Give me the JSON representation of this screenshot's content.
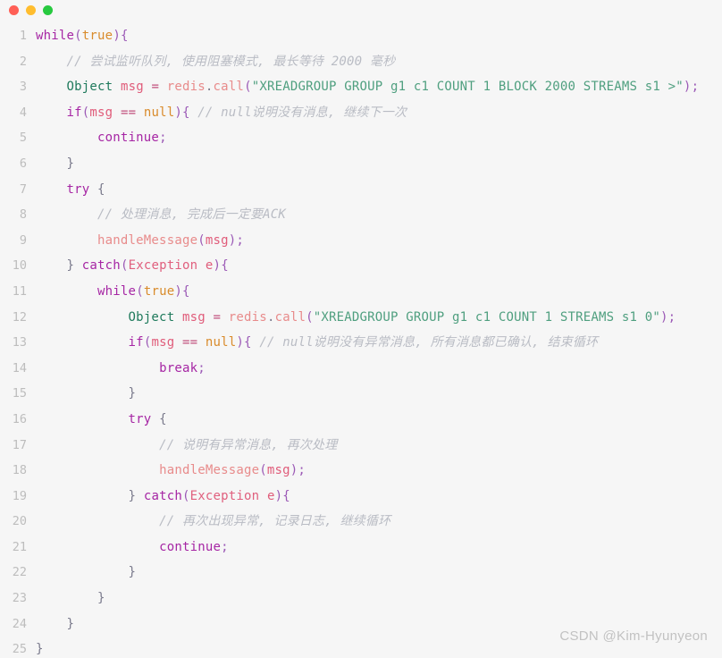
{
  "window": {
    "controls": [
      {
        "name": "close",
        "color": "#ff5f56"
      },
      {
        "name": "minimize",
        "color": "#ffbd2e"
      },
      {
        "name": "maximize",
        "color": "#27c93f"
      }
    ],
    "background": "#f6f6f6"
  },
  "watermark": "CSDN @Kim-Hyunyeon",
  "code": {
    "language": "java",
    "line_numbers": [
      "1",
      "2",
      "3",
      "4",
      "5",
      "6",
      "7",
      "8",
      "9",
      "10",
      "11",
      "12",
      "13",
      "14",
      "15",
      "16",
      "17",
      "18",
      "19",
      "20",
      "21",
      "22",
      "23",
      "24",
      "25"
    ],
    "lines": [
      {
        "n": "1",
        "text": "while(true){"
      },
      {
        "n": "2",
        "text": "    // 尝试监听队列, 使用阻塞模式, 最长等待 2000 毫秒"
      },
      {
        "n": "3",
        "text": "    Object msg = redis.call(\"XREADGROUP GROUP g1 c1 COUNT 1 BLOCK 2000 STREAMS s1 >\");"
      },
      {
        "n": "4",
        "text": "    if(msg == null){ // null说明没有消息, 继续下一次"
      },
      {
        "n": "5",
        "text": "        continue;"
      },
      {
        "n": "6",
        "text": "    }"
      },
      {
        "n": "7",
        "text": "    try {"
      },
      {
        "n": "8",
        "text": "        // 处理消息, 完成后一定要ACK"
      },
      {
        "n": "9",
        "text": "        handleMessage(msg);"
      },
      {
        "n": "10",
        "text": "    } catch(Exception e){"
      },
      {
        "n": "11",
        "text": "        while(true){"
      },
      {
        "n": "12",
        "text": "            Object msg = redis.call(\"XREADGROUP GROUP g1 c1 COUNT 1 STREAMS s1 0\");"
      },
      {
        "n": "13",
        "text": "            if(msg == null){ // null说明没有异常消息, 所有消息都已确认, 结束循环"
      },
      {
        "n": "14",
        "text": "                break;"
      },
      {
        "n": "15",
        "text": "            }"
      },
      {
        "n": "16",
        "text": "            try {"
      },
      {
        "n": "17",
        "text": "                // 说明有异常消息, 再次处理"
      },
      {
        "n": "18",
        "text": "                handleMessage(msg);"
      },
      {
        "n": "19",
        "text": "            } catch(Exception e){"
      },
      {
        "n": "20",
        "text": "                // 再次出现异常, 记录日志, 继续循环"
      },
      {
        "n": "21",
        "text": "                continue;"
      },
      {
        "n": "22",
        "text": "            }"
      },
      {
        "n": "23",
        "text": "        }"
      },
      {
        "n": "24",
        "text": "    }"
      },
      {
        "n": "25",
        "text": "}"
      }
    ],
    "tokens": [
      [
        {
          "t": "while",
          "c": "kw"
        },
        {
          "t": "(",
          "c": "pun"
        },
        {
          "t": "true",
          "c": "lit"
        },
        {
          "t": ")",
          "c": "pun"
        },
        {
          "t": "{",
          "c": "pun"
        }
      ],
      [
        {
          "t": "    ",
          "c": "pun2"
        },
        {
          "t": "// 尝试监听队列, 使用阻塞模式, 最长等待 2000 毫秒",
          "c": "cmt"
        }
      ],
      [
        {
          "t": "    ",
          "c": "pun2"
        },
        {
          "t": "Object",
          "c": "typ"
        },
        {
          "t": " ",
          "c": "pun2"
        },
        {
          "t": "msg",
          "c": "var"
        },
        {
          "t": " ",
          "c": "pun2"
        },
        {
          "t": "=",
          "c": "op"
        },
        {
          "t": " ",
          "c": "pun2"
        },
        {
          "t": "redis",
          "c": "fn"
        },
        {
          "t": ".",
          "c": "pun2"
        },
        {
          "t": "call",
          "c": "fn"
        },
        {
          "t": "(",
          "c": "pun"
        },
        {
          "t": "\"XREADGROUP GROUP g1 c1 COUNT 1 BLOCK 2000 STREAMS s1 >\"",
          "c": "str"
        },
        {
          "t": ")",
          "c": "pun"
        },
        {
          "t": ";",
          "c": "pun"
        }
      ],
      [
        {
          "t": "    ",
          "c": "pun2"
        },
        {
          "t": "if",
          "c": "kw"
        },
        {
          "t": "(",
          "c": "pun"
        },
        {
          "t": "msg",
          "c": "var"
        },
        {
          "t": " ",
          "c": "pun2"
        },
        {
          "t": "==",
          "c": "op"
        },
        {
          "t": " ",
          "c": "pun2"
        },
        {
          "t": "null",
          "c": "lit"
        },
        {
          "t": ")",
          "c": "pun"
        },
        {
          "t": "{",
          "c": "pun"
        },
        {
          "t": " ",
          "c": "pun2"
        },
        {
          "t": "// null说明没有消息, 继续下一次",
          "c": "cmt"
        }
      ],
      [
        {
          "t": "        ",
          "c": "pun2"
        },
        {
          "t": "continue",
          "c": "kw"
        },
        {
          "t": ";",
          "c": "pun"
        }
      ],
      [
        {
          "t": "    ",
          "c": "pun2"
        },
        {
          "t": "}",
          "c": "pun2"
        }
      ],
      [
        {
          "t": "    ",
          "c": "pun2"
        },
        {
          "t": "try",
          "c": "kw"
        },
        {
          "t": " ",
          "c": "pun2"
        },
        {
          "t": "{",
          "c": "pun2"
        }
      ],
      [
        {
          "t": "        ",
          "c": "pun2"
        },
        {
          "t": "// 处理消息, 完成后一定要ACK",
          "c": "cmt"
        }
      ],
      [
        {
          "t": "        ",
          "c": "pun2"
        },
        {
          "t": "handleMessage",
          "c": "fn"
        },
        {
          "t": "(",
          "c": "pun"
        },
        {
          "t": "msg",
          "c": "var"
        },
        {
          "t": ")",
          "c": "pun"
        },
        {
          "t": ";",
          "c": "pun"
        }
      ],
      [
        {
          "t": "    ",
          "c": "pun2"
        },
        {
          "t": "}",
          "c": "pun2"
        },
        {
          "t": " ",
          "c": "pun2"
        },
        {
          "t": "catch",
          "c": "kw"
        },
        {
          "t": "(",
          "c": "pun"
        },
        {
          "t": "Exception",
          "c": "cls"
        },
        {
          "t": " ",
          "c": "pun2"
        },
        {
          "t": "e",
          "c": "var"
        },
        {
          "t": ")",
          "c": "pun"
        },
        {
          "t": "{",
          "c": "pun"
        }
      ],
      [
        {
          "t": "        ",
          "c": "pun2"
        },
        {
          "t": "while",
          "c": "kw"
        },
        {
          "t": "(",
          "c": "pun"
        },
        {
          "t": "true",
          "c": "lit"
        },
        {
          "t": ")",
          "c": "pun"
        },
        {
          "t": "{",
          "c": "pun"
        }
      ],
      [
        {
          "t": "            ",
          "c": "pun2"
        },
        {
          "t": "Object",
          "c": "typ"
        },
        {
          "t": " ",
          "c": "pun2"
        },
        {
          "t": "msg",
          "c": "var"
        },
        {
          "t": " ",
          "c": "pun2"
        },
        {
          "t": "=",
          "c": "op"
        },
        {
          "t": " ",
          "c": "pun2"
        },
        {
          "t": "redis",
          "c": "fn"
        },
        {
          "t": ".",
          "c": "pun2"
        },
        {
          "t": "call",
          "c": "fn"
        },
        {
          "t": "(",
          "c": "pun"
        },
        {
          "t": "\"XREADGROUP GROUP g1 c1 COUNT 1 STREAMS s1 0\"",
          "c": "str"
        },
        {
          "t": ")",
          "c": "pun"
        },
        {
          "t": ";",
          "c": "pun"
        }
      ],
      [
        {
          "t": "            ",
          "c": "pun2"
        },
        {
          "t": "if",
          "c": "kw"
        },
        {
          "t": "(",
          "c": "pun"
        },
        {
          "t": "msg",
          "c": "var"
        },
        {
          "t": " ",
          "c": "pun2"
        },
        {
          "t": "==",
          "c": "op"
        },
        {
          "t": " ",
          "c": "pun2"
        },
        {
          "t": "null",
          "c": "lit"
        },
        {
          "t": ")",
          "c": "pun"
        },
        {
          "t": "{",
          "c": "pun"
        },
        {
          "t": " ",
          "c": "pun2"
        },
        {
          "t": "// null说明没有异常消息, 所有消息都已确认, 结束循环",
          "c": "cmt"
        }
      ],
      [
        {
          "t": "                ",
          "c": "pun2"
        },
        {
          "t": "break",
          "c": "kw"
        },
        {
          "t": ";",
          "c": "pun"
        }
      ],
      [
        {
          "t": "            ",
          "c": "pun2"
        },
        {
          "t": "}",
          "c": "pun2"
        }
      ],
      [
        {
          "t": "            ",
          "c": "pun2"
        },
        {
          "t": "try",
          "c": "kw"
        },
        {
          "t": " ",
          "c": "pun2"
        },
        {
          "t": "{",
          "c": "pun2"
        }
      ],
      [
        {
          "t": "                ",
          "c": "pun2"
        },
        {
          "t": "// 说明有异常消息, 再次处理",
          "c": "cmt"
        }
      ],
      [
        {
          "t": "                ",
          "c": "pun2"
        },
        {
          "t": "handleMessage",
          "c": "fn"
        },
        {
          "t": "(",
          "c": "pun"
        },
        {
          "t": "msg",
          "c": "var"
        },
        {
          "t": ")",
          "c": "pun"
        },
        {
          "t": ";",
          "c": "pun"
        }
      ],
      [
        {
          "t": "            ",
          "c": "pun2"
        },
        {
          "t": "}",
          "c": "pun2"
        },
        {
          "t": " ",
          "c": "pun2"
        },
        {
          "t": "catch",
          "c": "kw"
        },
        {
          "t": "(",
          "c": "pun"
        },
        {
          "t": "Exception",
          "c": "cls"
        },
        {
          "t": " ",
          "c": "pun2"
        },
        {
          "t": "e",
          "c": "var"
        },
        {
          "t": ")",
          "c": "pun"
        },
        {
          "t": "{",
          "c": "pun"
        }
      ],
      [
        {
          "t": "                ",
          "c": "pun2"
        },
        {
          "t": "// 再次出现异常, 记录日志, 继续循环",
          "c": "cmt"
        }
      ],
      [
        {
          "t": "                ",
          "c": "pun2"
        },
        {
          "t": "continue",
          "c": "kw"
        },
        {
          "t": ";",
          "c": "pun"
        }
      ],
      [
        {
          "t": "            ",
          "c": "pun2"
        },
        {
          "t": "}",
          "c": "pun2"
        }
      ],
      [
        {
          "t": "        ",
          "c": "pun2"
        },
        {
          "t": "}",
          "c": "pun2"
        }
      ],
      [
        {
          "t": "    ",
          "c": "pun2"
        },
        {
          "t": "}",
          "c": "pun2"
        }
      ],
      [
        {
          "t": "}",
          "c": "pun2"
        }
      ]
    ]
  }
}
